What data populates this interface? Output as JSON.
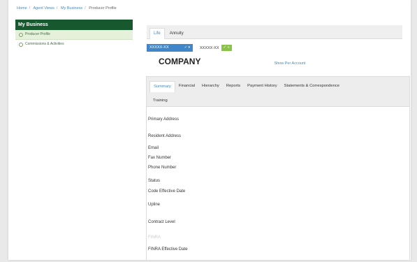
{
  "breadcrumb": [
    "Home",
    "Agent Views",
    "My Business",
    "Producer Profile"
  ],
  "sidebar": {
    "header": "My Business",
    "items": [
      {
        "label": "Producer Profile"
      },
      {
        "label": "Commissions & Activities"
      }
    ]
  },
  "top_tabs": [
    "Life",
    "Annuity"
  ],
  "selector": {
    "value": "XXXXX-XX",
    "second_value": "XXXXX-XX",
    "go_label": "✓ »"
  },
  "company": "COMPANY",
  "show_link": "Show Per Account",
  "tabs_row1": [
    "Summary",
    "Financial",
    "Hierarchy",
    "Reports",
    "Payment History",
    "Statements & Correspondence"
  ],
  "tabs_row2": [
    "Training"
  ],
  "fields": {
    "primary_address": "Primary Address",
    "resident_address": "Resident Address",
    "email": "Email",
    "fax": "Fax Number",
    "phone": "Phone Number",
    "status": "Status",
    "code_effective": "Code Effective Date",
    "upline": "Upline",
    "contract_level": "Contract Level",
    "faded_label": "FINRA",
    "finra_effective": "FINRA Effective Date"
  }
}
